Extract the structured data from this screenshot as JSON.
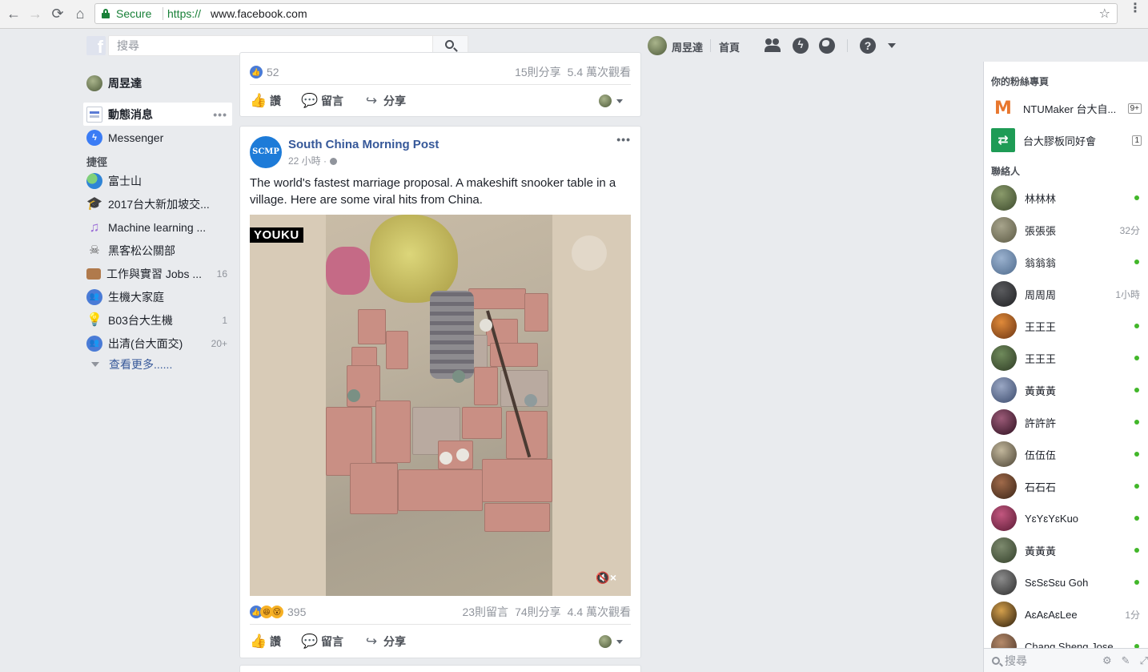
{
  "browser": {
    "back_icon": "←",
    "forward_icon": "→",
    "reload_icon": "⟳",
    "home_icon": "⌂",
    "secure_label": "Secure",
    "url_scheme": "https://",
    "url_host": "www.facebook.com",
    "star_icon": "☆",
    "menu_icon": "⋮"
  },
  "topbar": {
    "logo": "f",
    "search_placeholder": "搜尋",
    "user_name": "周昱達",
    "home_label": "首頁",
    "help_glyph": "?"
  },
  "leftnav": {
    "user": "周昱達",
    "news_feed": "動態消息",
    "news_more": "•••",
    "messenger": "Messenger",
    "messenger_glyph": "ϟ",
    "shortcuts_heading": "捷徑",
    "shortcuts": [
      {
        "label": "富士山",
        "count": "",
        "glyph": ""
      },
      {
        "label": "2017台大新加坡交...",
        "count": "",
        "glyph": "🎓"
      },
      {
        "label": "Machine learning ...",
        "count": "",
        "glyph": "♫"
      },
      {
        "label": "黑客松公關部",
        "count": "",
        "glyph": "☠"
      },
      {
        "label": "工作與實習 Jobs ...",
        "count": "16",
        "glyph": ""
      },
      {
        "label": "生機大家庭",
        "count": "",
        "glyph": "👥"
      },
      {
        "label": "B03台大生機",
        "count": "1",
        "glyph": "💡"
      },
      {
        "label": "出清(台大面交)",
        "count": "20+",
        "glyph": "👥"
      }
    ],
    "see_more": "查看更多......"
  },
  "post_prev": {
    "like_count": "52",
    "shares": "15則分享",
    "views": "5.4 萬次觀看",
    "like_glyph": "👍"
  },
  "post": {
    "page_name": "South China Morning Post",
    "page_logo_text": "SCMP",
    "time": "22 小時 ·",
    "more": "•••",
    "text": "The world's fastest marriage proposal. A makeshift snooker table in a village. Here are some viral hits from China.",
    "video_watermark": "YOUKU",
    "mute_icon": "🔇×",
    "reaction_count": "395",
    "comments": "23則留言",
    "shares": "74則分享",
    "views": "4.4 萬次觀看",
    "haha_glyph": "😆",
    "wow_glyph": "😮"
  },
  "actions": {
    "like": "讚",
    "comment": "留言",
    "share": "分享",
    "like_icon": "👍",
    "comment_icon": "💬",
    "share_icon": "↪"
  },
  "rightbar": {
    "pages_heading": "你的粉絲專頁",
    "pages": [
      {
        "name": "NTUMaker 台大自...",
        "badge": "9+",
        "glyph": "M"
      },
      {
        "name": "台大膠板同好會",
        "badge": "1",
        "glyph": "⇄"
      }
    ],
    "contacts_heading": "聯絡人",
    "contacts": [
      {
        "name": "林林林",
        "status": "online",
        "time": ""
      },
      {
        "name": "張張張",
        "status": "idle",
        "time": "32分"
      },
      {
        "name": "翁翁翁",
        "status": "online",
        "time": ""
      },
      {
        "name": "周周周",
        "status": "idle",
        "time": "1小時"
      },
      {
        "name": "王王王",
        "status": "online",
        "time": ""
      },
      {
        "name": "王王王",
        "status": "online",
        "time": ""
      },
      {
        "name": "黃黃黃",
        "status": "online",
        "time": ""
      },
      {
        "name": "許許許",
        "status": "online",
        "time": ""
      },
      {
        "name": "伍伍伍",
        "status": "online",
        "time": ""
      },
      {
        "name": "石石石",
        "status": "online",
        "time": ""
      },
      {
        "name": "YɛYɛYɛKuo",
        "status": "online",
        "time": ""
      },
      {
        "name": "黃黃黃",
        "status": "online",
        "time": ""
      },
      {
        "name": "SɛSɛSɛu Goh",
        "status": "online",
        "time": ""
      },
      {
        "name": "AɛAɛAɛLee",
        "status": "idle",
        "time": "1分"
      },
      {
        "name": "Chang Sheng Jose",
        "status": "online",
        "time": ""
      }
    ],
    "search_placeholder": "搜尋",
    "settings_icon": "⚙",
    "compose_icon": "✎",
    "expand_icon": "⤢"
  },
  "colors": {
    "fb_blue": "#365899",
    "online_green": "#42b72a",
    "secure_green": "#188038"
  }
}
